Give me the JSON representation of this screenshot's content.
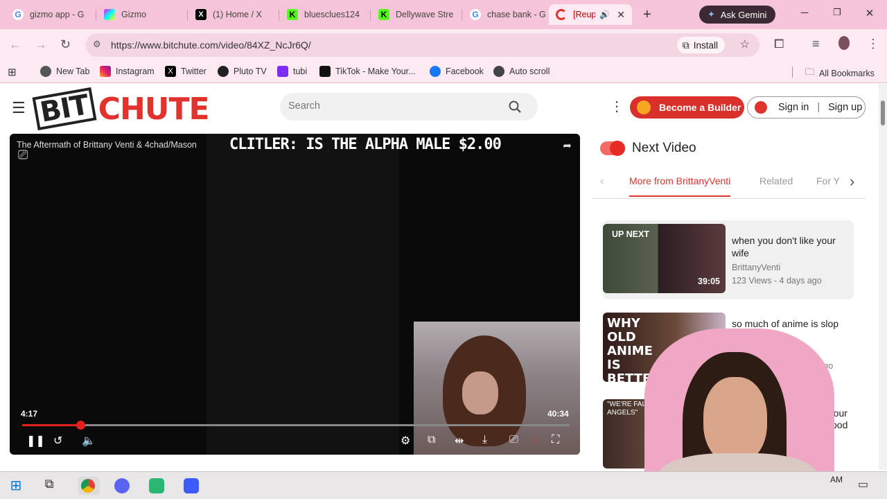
{
  "browser": {
    "tabs": [
      {
        "label": "gizmo app - G",
        "active": false
      },
      {
        "label": "Gizmo",
        "active": false
      },
      {
        "label": "(1) Home / X",
        "active": false
      },
      {
        "label": "bluesclues124",
        "active": false
      },
      {
        "label": "Dellywave Stre",
        "active": false
      },
      {
        "label": "chase bank - G",
        "active": false
      },
      {
        "label": "[Reupl",
        "active": true
      }
    ],
    "new_tab": "+",
    "gemini_label": "Ask Gemini",
    "url": "https://www.bitchute.com/video/84XZ_NcJr6Q/",
    "install_label": "Install",
    "bookmarks": [
      {
        "label": "New Tab"
      },
      {
        "label": "Instagram"
      },
      {
        "label": "Twitter"
      },
      {
        "label": "Pluto TV"
      },
      {
        "label": "tubi"
      },
      {
        "label": "TikTok - Make Your..."
      },
      {
        "label": "Facebook"
      },
      {
        "label": "Auto scroll"
      }
    ],
    "all_bookmarks": "All Bookmarks"
  },
  "site": {
    "logo_bit": "BIT",
    "logo_chute": "CHUTE",
    "search_placeholder": "Search",
    "builder_label": "Become a Builder",
    "sign_in": "Sign in",
    "sign_sep": "|",
    "sign_up": "Sign up"
  },
  "video": {
    "title": "The Aftermath of Brittany Venti & 4chad/Mason",
    "overlay_text": "CLITLER: IS THE ALPHA MALE $2.00",
    "current_time": "4:17",
    "duration": "40:34",
    "progress": 0.106
  },
  "sidebar": {
    "next_video_label": "Next Video",
    "tabs": [
      {
        "label": "More from BrittanyVenti",
        "active": true
      },
      {
        "label": "Related",
        "active": false
      },
      {
        "label": "For Y",
        "active": false
      }
    ],
    "cards": [
      {
        "upnext": "UP NEXT",
        "title": "when you don't like your wife",
        "channel": "BrittanyVenti",
        "meta": "123 Views - 4 days ago",
        "duration": "39:05",
        "thumb_text": ""
      },
      {
        "upnext": "",
        "title": "so much of anime is slop",
        "channel": "nti",
        "meta": "2 weeks ago",
        "duration": "",
        "thumb_text": "WHY OLD ANIME IS BETTER"
      },
      {
        "upnext": "",
        "title": "g your",
        "channel": "ood",
        "meta": "",
        "duration": "",
        "thumb_text": "\"WE'RE FALLE ANGELS\""
      }
    ]
  },
  "taskbar": {
    "clock": "AM"
  },
  "colors": {
    "accent": "#e0332e",
    "tab_strip": "#f6c4d8",
    "toolbar": "#fde9f1"
  }
}
